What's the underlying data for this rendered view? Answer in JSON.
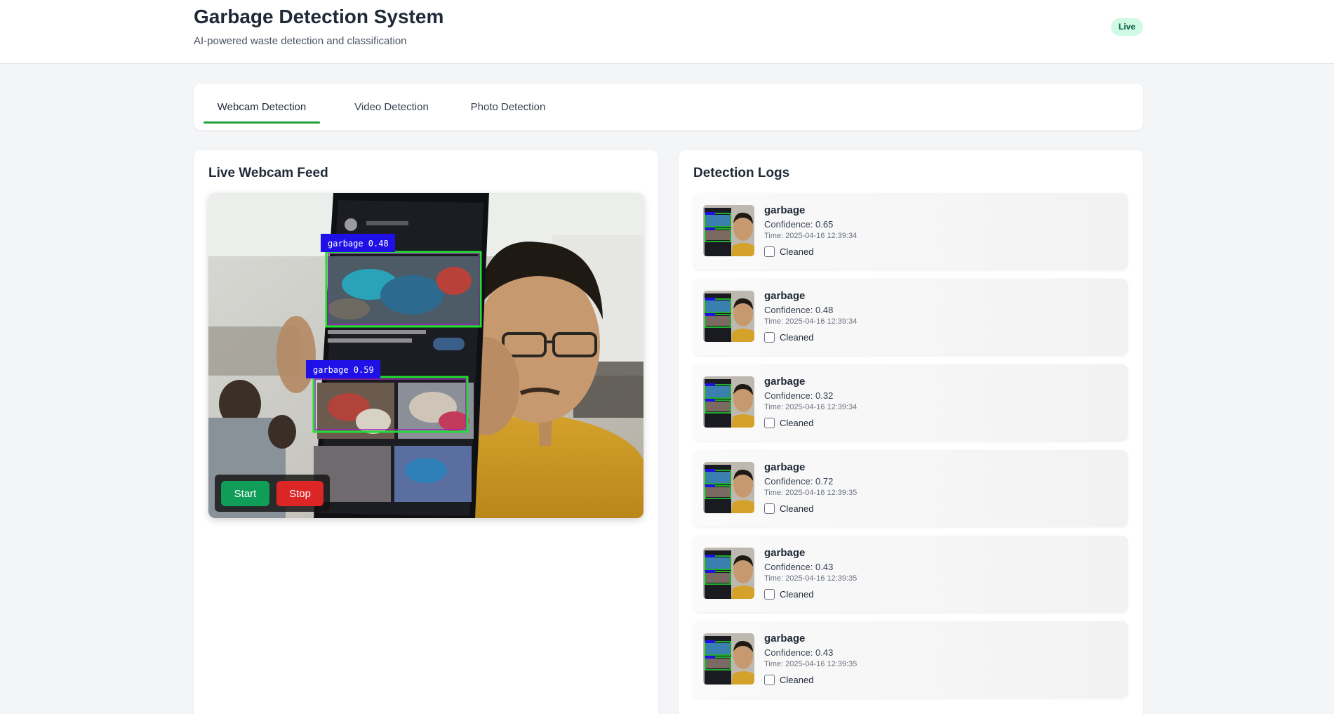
{
  "header": {
    "title": "Garbage Detection System",
    "subtitle": "AI-powered waste detection and classification",
    "status_badge": "Live"
  },
  "tabs": [
    {
      "label": "Webcam Detection",
      "active": true
    },
    {
      "label": "Video Detection",
      "active": false
    },
    {
      "label": "Photo Detection",
      "active": false
    }
  ],
  "webcam": {
    "title": "Live Webcam Feed",
    "detections": [
      {
        "label": "garbage 0.48"
      },
      {
        "label": "garbage 0.59"
      }
    ],
    "start_label": "Start",
    "stop_label": "Stop"
  },
  "logs": {
    "title": "Detection Logs",
    "entries": [
      {
        "label": "garbage",
        "confidence": "Confidence: 0.65",
        "time": "Time: 2025-04-16 12:39:34",
        "cleaned_label": "Cleaned"
      },
      {
        "label": "garbage",
        "confidence": "Confidence: 0.48",
        "time": "Time: 2025-04-16 12:39:34",
        "cleaned_label": "Cleaned"
      },
      {
        "label": "garbage",
        "confidence": "Confidence: 0.32",
        "time": "Time: 2025-04-16 12:39:34",
        "cleaned_label": "Cleaned"
      },
      {
        "label": "garbage",
        "confidence": "Confidence: 0.72",
        "time": "Time: 2025-04-16 12:39:35",
        "cleaned_label": "Cleaned"
      },
      {
        "label": "garbage",
        "confidence": "Confidence: 0.43",
        "time": "Time: 2025-04-16 12:39:35",
        "cleaned_label": "Cleaned"
      },
      {
        "label": "garbage",
        "confidence": "Confidence: 0.43",
        "time": "Time: 2025-04-16 12:39:35",
        "cleaned_label": "Cleaned"
      }
    ]
  },
  "colors": {
    "accent_green": "#22a03a",
    "start_button": "#0f9d58",
    "stop_button": "#dc2626",
    "detection_box": "#22c55e",
    "detection_label_bg": "#1e10e6"
  }
}
